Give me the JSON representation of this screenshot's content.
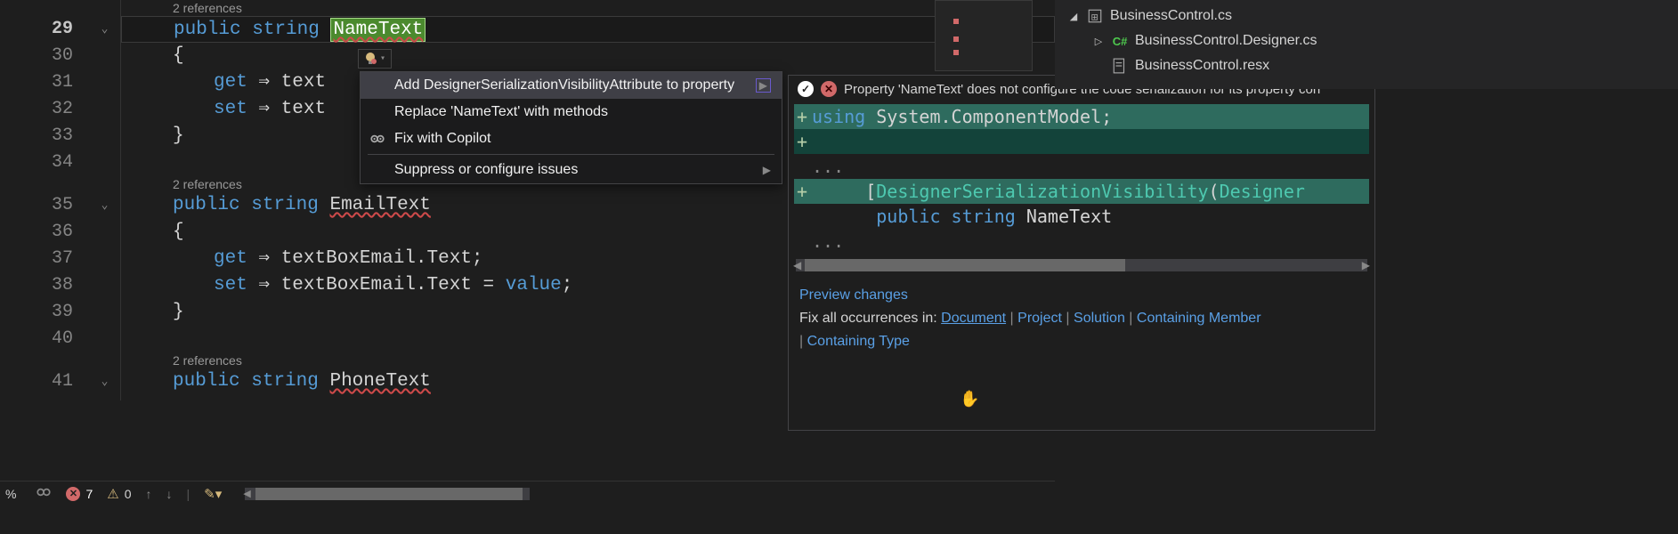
{
  "editor": {
    "lines": [
      "29",
      "30",
      "31",
      "32",
      "33",
      "34",
      "35",
      "36",
      "37",
      "38",
      "39",
      "40",
      "41"
    ],
    "codelens": "2 references",
    "code": {
      "l29_public": "public",
      "l29_string": "string",
      "l29_name": "NameText",
      "l30_brace": "{",
      "l31_get": "get",
      "l31_arrow": "⇒",
      "l31_rest": "text",
      "l32_set": "set",
      "l32_arrow": "⇒",
      "l32_rest": "text",
      "l33_brace": "}",
      "l35_public": "public",
      "l35_string": "string",
      "l35_name": "EmailText",
      "l36_brace": "{",
      "l37_get": "get",
      "l37_arrow": "⇒",
      "l37_rest": "textBoxEmail.Text;",
      "l38_set": "set",
      "l38_arrow": "⇒",
      "l38_rest": "textBoxEmail.Text = ",
      "l38_value": "value",
      "l38_semi": ";",
      "l39_brace": "}",
      "l41_public": "public",
      "l41_string": "string",
      "l41_name": "PhoneText"
    }
  },
  "menu": {
    "item1": "Add DesignerSerializationVisibilityAttribute to property",
    "item2": "Replace 'NameText' with methods",
    "item3": "Fix with Copilot",
    "item4": "Suppress or configure issues"
  },
  "preview": {
    "header_text": "Property 'NameText' does not configure the code serialization for its property con",
    "code_line1_kw": "using",
    "code_line1_rest": " System.ComponentModel;",
    "code_dots": "...",
    "code_attr_open": "[",
    "code_attr_name": "DesignerSerializationVisibility",
    "code_attr_paren": "(",
    "code_attr_arg": "Designer",
    "code_sig_public": "public",
    "code_sig_string": "string",
    "code_sig_name": " NameText",
    "link_preview": "Preview changes",
    "fix_label": "Fix all occurrences in: ",
    "link_document": "Document",
    "link_project": "Project",
    "link_solution": "Solution",
    "link_member": "Containing Member",
    "link_type": "Containing Type",
    "sep": " | "
  },
  "solution": {
    "file1": "BusinessControl.cs",
    "file2": "BusinessControl.Designer.cs",
    "file3": "BusinessControl.resx"
  },
  "status": {
    "pct": "%",
    "errors": "7",
    "warnings": "0"
  }
}
